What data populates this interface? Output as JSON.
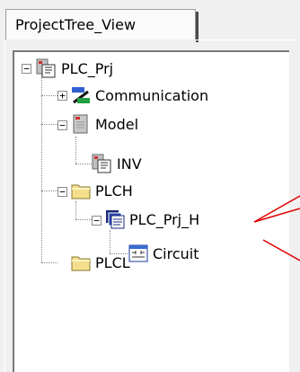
{
  "tab": {
    "label": "ProjectTree_View"
  },
  "tree": {
    "root": {
      "label": "PLC_Prj",
      "expander": "−"
    },
    "communication": {
      "label": "Communication",
      "expander": "+"
    },
    "model": {
      "label": "Model",
      "expander": "−"
    },
    "inv": {
      "label": "INV"
    },
    "plch": {
      "label": "PLCH",
      "expander": "−"
    },
    "plc_prj_h": {
      "label": "PLC_Prj_H",
      "expander": "−"
    },
    "circuit": {
      "label": "Circuit"
    },
    "plcl": {
      "label": "PLCL"
    }
  },
  "colors": {
    "callout": "#e00000",
    "folder": "#f3df8c",
    "selection": "#ffffff"
  },
  "icons": [
    "project-icon",
    "communication-icon",
    "model-icon",
    "inv-icon",
    "folder-icon",
    "program-icon",
    "circuit-icon",
    "folder-icon"
  ]
}
